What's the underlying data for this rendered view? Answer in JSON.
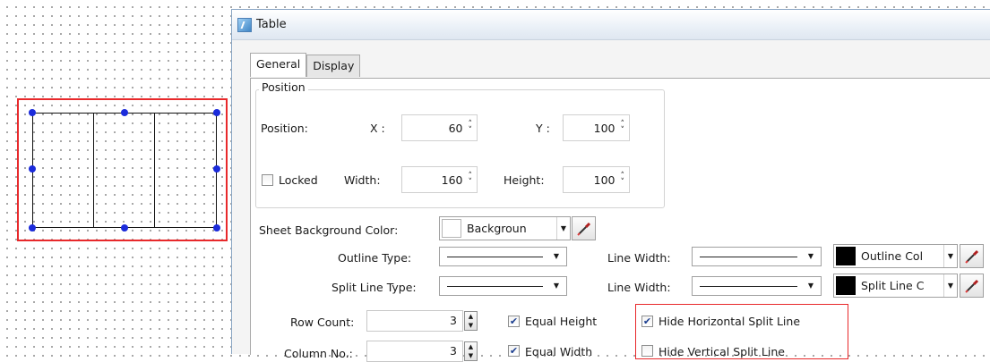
{
  "window": {
    "title": "Table"
  },
  "tabs": [
    {
      "label": "General",
      "active": true
    },
    {
      "label": "Display",
      "active": false
    }
  ],
  "position": {
    "group_label": "Position",
    "row_label": "Position:",
    "x_label": "X :",
    "x_value": "60",
    "y_label": "Y :",
    "y_value": "100",
    "locked_label": "Locked",
    "locked_checked": false,
    "width_label": "Width:",
    "width_value": "160",
    "height_label": "Height:",
    "height_value": "100"
  },
  "sheet": {
    "bg_label": "Sheet Background Color:",
    "bg_value": "Backgroun",
    "bg_color": "#ffffff"
  },
  "outline": {
    "type_label": "Outline Type:",
    "width_label": "Line Width:",
    "color_value": "Outline Col",
    "color": "#000000"
  },
  "split": {
    "type_label": "Split Line Type:",
    "width_label": "Line Width:",
    "color_value": "Split Line C",
    "color": "#000000"
  },
  "counts": {
    "row_label": "Row Count:",
    "row_value": "3",
    "col_label": "Column No.:",
    "col_value": "3"
  },
  "options": {
    "equal_height_label": "Equal Height",
    "equal_height_checked": true,
    "equal_width_label": "Equal Width",
    "equal_width_checked": true,
    "hide_horizontal_label": "Hide Horizontal Split Line",
    "hide_horizontal_checked": true,
    "hide_vertical_label": "Hide Vertical Split Line",
    "hide_vertical_checked": false
  },
  "icons": {
    "app": "table-icon",
    "picker": "eyedropper-icon",
    "spin": "chevron-updown-icon"
  },
  "colors": {
    "selection": "#e8292b",
    "handle": "#1b2bdb"
  }
}
